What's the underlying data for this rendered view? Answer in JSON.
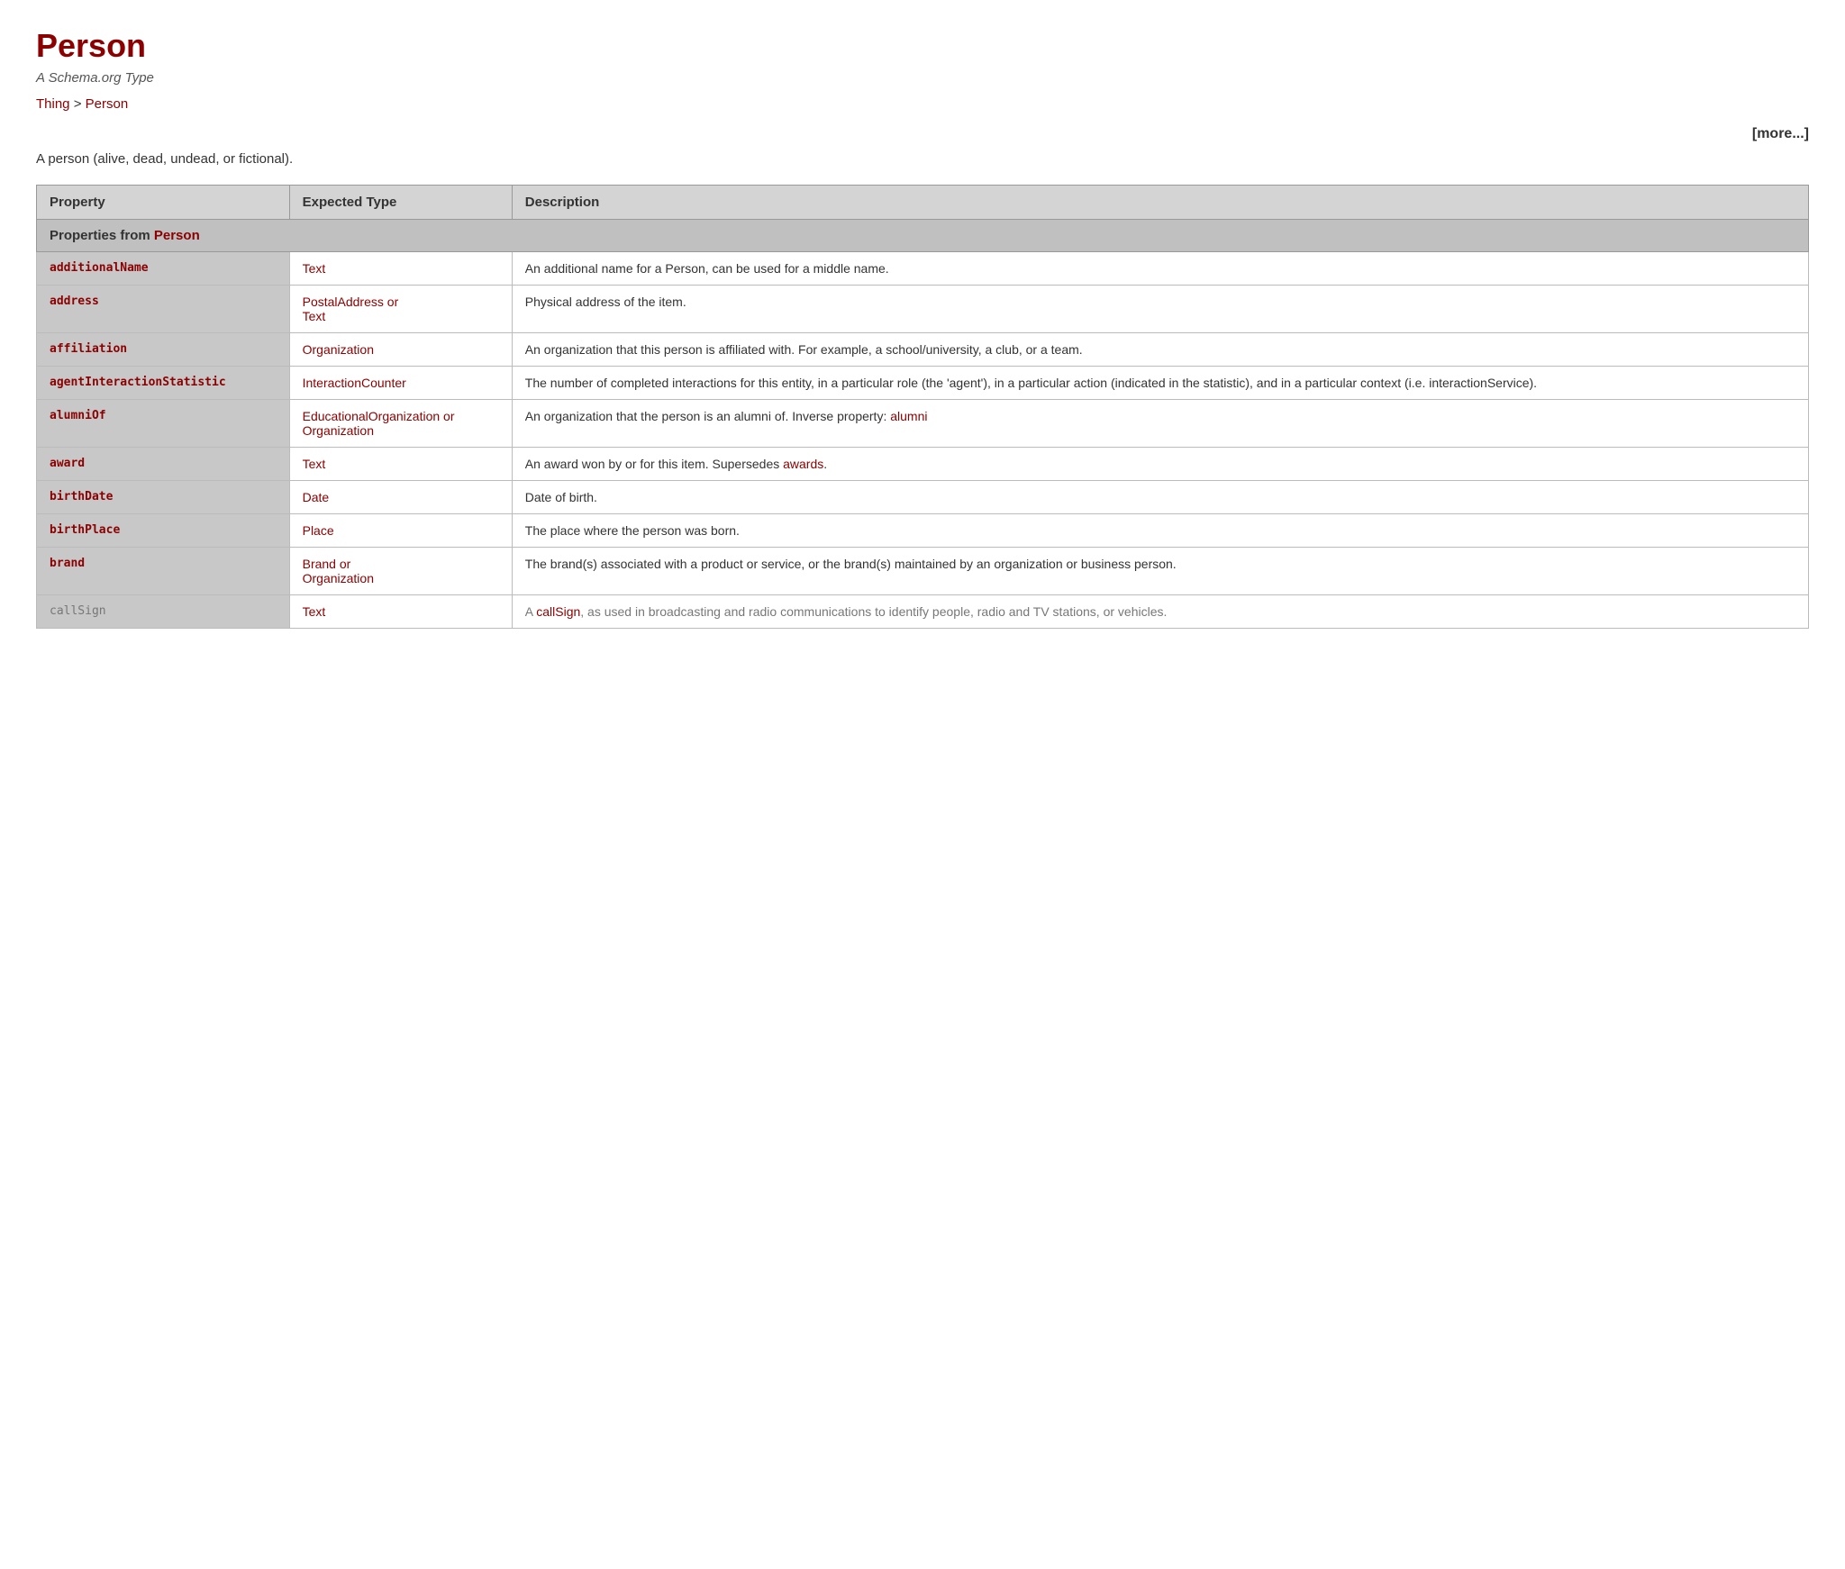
{
  "header": {
    "title": "Person",
    "subtitle": "A Schema.org Type",
    "breadcrumb": [
      {
        "label": "Thing",
        "href": "#"
      },
      {
        "label": "Person",
        "href": "#"
      }
    ],
    "more_link": "[more...]",
    "description": "A person (alive, dead, undead, or fictional)."
  },
  "table": {
    "columns": [
      "Property",
      "Expected Type",
      "Description"
    ],
    "section_label": "Properties from",
    "section_highlight": "Person",
    "rows": [
      {
        "property": "additionalName",
        "type_html": "Text",
        "description": "An additional name for a Person, can be used for a middle name."
      },
      {
        "property": "address",
        "type_html": "PostalAddress  or  Text",
        "description": "Physical address of the item."
      },
      {
        "property": "affiliation",
        "type_html": "Organization",
        "description": "An organization that this person is affiliated with. For example, a school/university, a club, or a team."
      },
      {
        "property": "agentInteractionStatistic",
        "type_html": "InteractionCounter",
        "description": "The number of completed interactions for this entity, in a particular role (the 'agent'), in a particular action (indicated in the statistic), and in a particular context (i.e. interactionService)."
      },
      {
        "property": "alumniOf",
        "type_html": "EducationalOrganization  or  Organization",
        "description": "An organization that the person is an alumni of. Inverse property: alumni"
      },
      {
        "property": "award",
        "type_html": "Text",
        "description": "An award won by or for this item. Supersedes awards."
      },
      {
        "property": "birthDate",
        "type_html": "Date",
        "description": "Date of birth."
      },
      {
        "property": "birthPlace",
        "type_html": "Place",
        "description": "The place where the person was born."
      },
      {
        "property": "brand",
        "type_html": "Brand  or  Organization",
        "description": "The brand(s) associated with a product or service, or the brand(s) maintained by an organization or business person."
      },
      {
        "property": "callSign",
        "type_html": "Text",
        "description": "A callSign, as used in broadcasting and radio communications to identify people, radio and TV stations, or vehicles.",
        "faded": true
      }
    ]
  }
}
